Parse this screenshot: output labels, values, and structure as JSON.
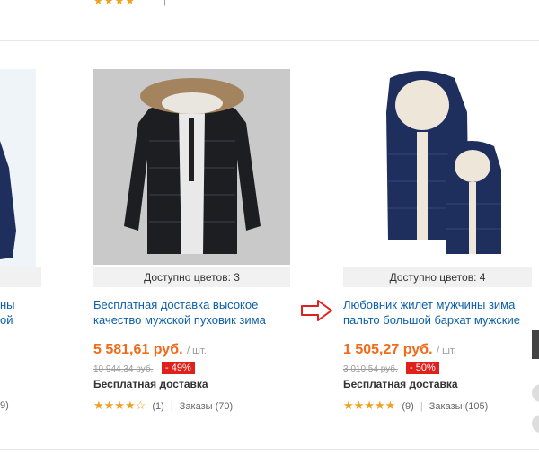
{
  "top_row": {
    "stars": "★★★★",
    "meta_text": "|  "
  },
  "left_card": {
    "title_line1": "ны",
    "title_line2": "ой",
    "rating_tail": "9)"
  },
  "products": [
    {
      "colors_label": "Доступно цветов: 3",
      "title": "Бесплатная доставка высокое качество мужской пуховик зима",
      "price": "5 581,61 руб.",
      "unit": "/ шт.",
      "old_price": "10 944,34 руб.",
      "discount": "- 49%",
      "shipping": "Бесплатная доставка",
      "stars": "★★★★☆",
      "reviews": "(1)",
      "orders": "Заказы (70)",
      "colors": {
        "bg": "#c9c9c9",
        "jacket": "#1c1e22",
        "fur": "#a4845e"
      }
    },
    {
      "colors_label": "Доступно цветов: 4",
      "title": "Любовник жилет мужчины зима пальто большой бархат мужские",
      "price": "1 505,27 руб.",
      "unit": "/ шт.",
      "old_price": "3 010,54 руб.",
      "discount": "- 50%",
      "shipping": "Бесплатная доставка",
      "stars": "★★★★★",
      "reviews": "(9)",
      "orders": "Заказы (105)",
      "colors": {
        "vest": "#1e2f5e",
        "lining": "#efe6da"
      }
    }
  ],
  "theme": {
    "link": "#0c5fa8",
    "price": "#f06b1a",
    "discount_bg": "#e0201c",
    "star": "#f0a020",
    "arrow": "#e0201c"
  }
}
